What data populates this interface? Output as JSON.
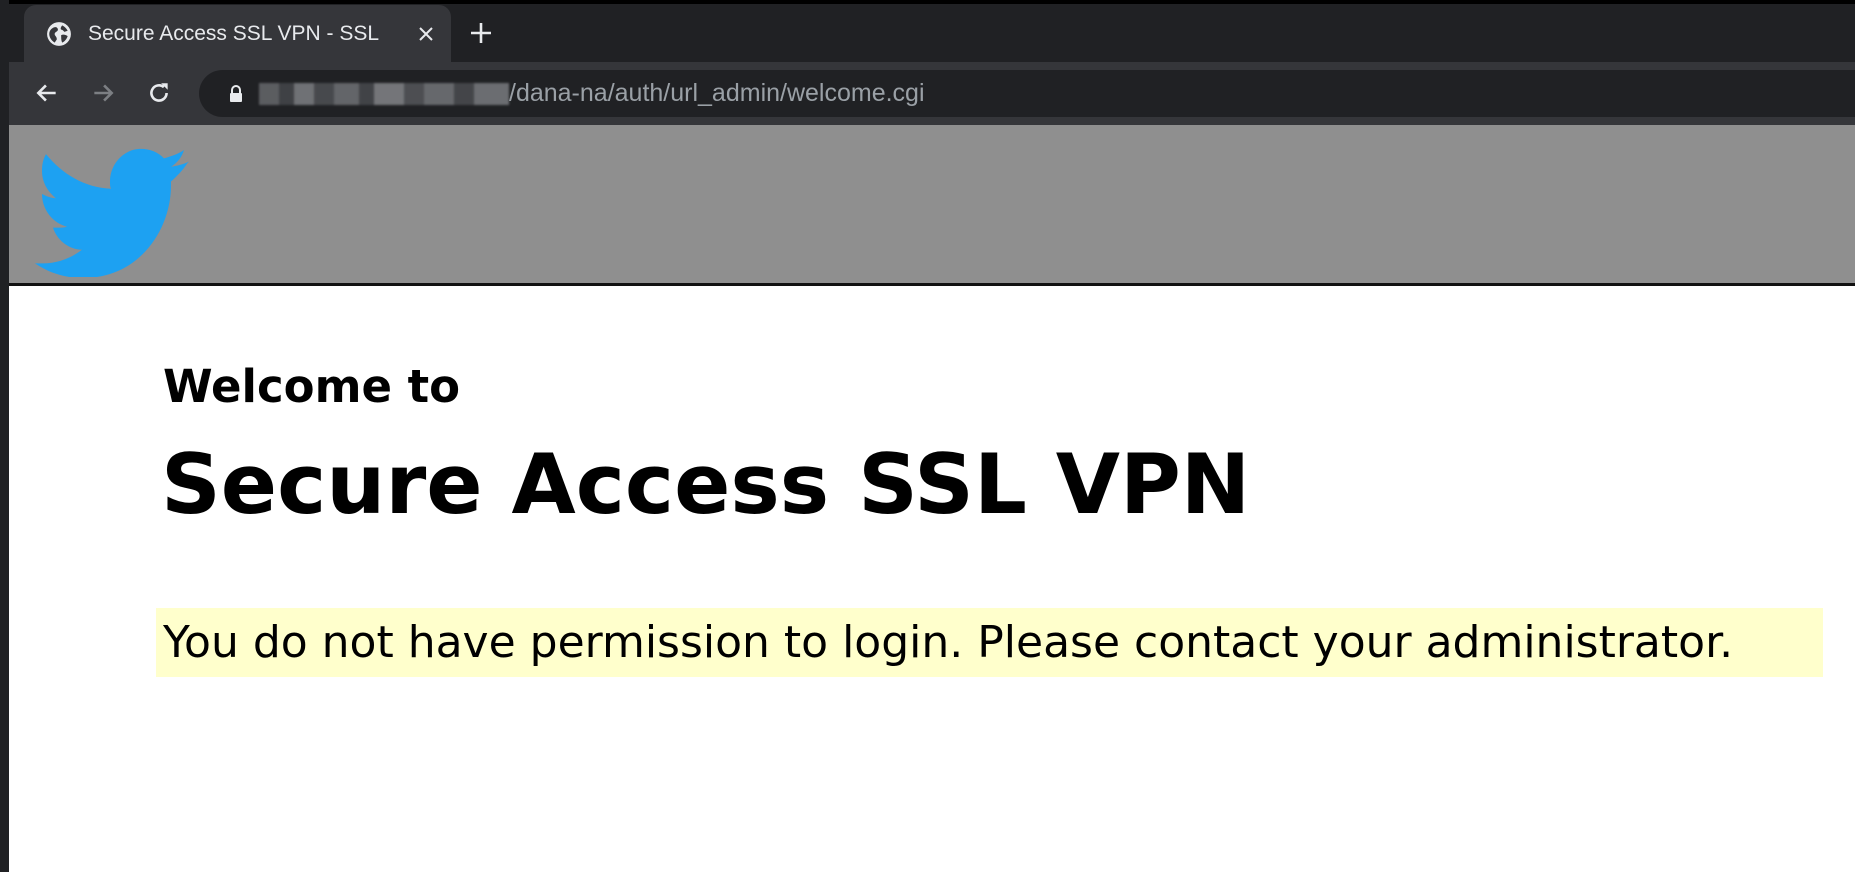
{
  "browser": {
    "tab": {
      "title": "Secure Access SSL VPN - SSL",
      "favicon": "globe-icon",
      "close_icon": "close-icon"
    },
    "new_tab_icon": "plus-icon",
    "toolbar": {
      "back_icon": "back-arrow-icon",
      "forward_icon": "forward-arrow-icon",
      "reload_icon": "reload-icon"
    },
    "address": {
      "lock_icon": "lock-icon",
      "host_redacted": true,
      "path": "/dana-na/auth/url_admin/welcome.cgi"
    }
  },
  "page": {
    "header": {
      "logo": "twitter-bird-logo",
      "background_color": "#8f8f8f",
      "logo_color": "#1da1f2"
    },
    "welcome_prefix": "Welcome to",
    "product_name": "Secure Access SSL VPN",
    "message": "You do not have permission to login. Please contact your administrator.",
    "message_background": "#ffffcc"
  }
}
